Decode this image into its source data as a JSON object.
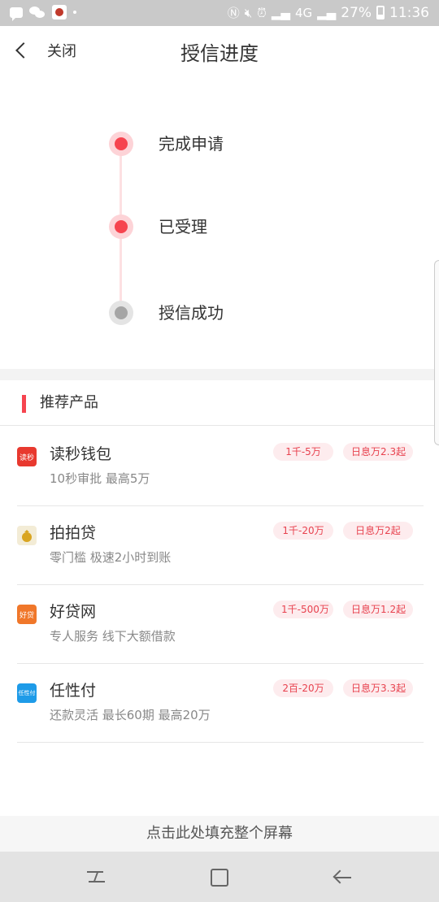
{
  "status_bar": {
    "battery": "27%",
    "time": "11:36",
    "network": "4G",
    "icons": [
      "message-icon",
      "wechat-icon",
      "app-icon",
      "nfc-icon",
      "mute-icon",
      "alarm-icon",
      "signal-icon",
      "battery-icon"
    ]
  },
  "header": {
    "back_label": "关闭",
    "title": "授信进度"
  },
  "progress": {
    "steps": [
      {
        "label": "完成申请",
        "state": "done"
      },
      {
        "label": "已受理",
        "state": "done"
      },
      {
        "label": "授信成功",
        "state": "pending"
      }
    ]
  },
  "recommend": {
    "title": "推荐产品",
    "products": [
      {
        "name": "读秒钱包",
        "desc": "10秒审批 最高5万",
        "amount": "1千-5万",
        "rate": "日息万2.3起",
        "icon": "dumiao-icon",
        "icon_text": "读秒",
        "icon_color": "#e8392f"
      },
      {
        "name": "拍拍贷",
        "desc": "零门槛 极速2小时到账",
        "amount": "1千-20万",
        "rate": "日息万2起",
        "icon": "paipaidai-icon",
        "icon_text": "",
        "icon_color": "#d9a521"
      },
      {
        "name": "好贷网",
        "desc": "专人服务 线下大额借款",
        "amount": "1千-500万",
        "rate": "日息万1.2起",
        "icon": "haodai-icon",
        "icon_text": "好贷",
        "icon_color": "#f0772a"
      },
      {
        "name": "任性付",
        "desc": "还款灵活 最长60期 最高20万",
        "amount": "2百-20万",
        "rate": "日息万3.3起",
        "icon": "renxingfu-icon",
        "icon_text": "任性付",
        "icon_color": "#1e9be8"
      }
    ]
  },
  "fill_screen": "点击此处填充整个屏幕",
  "colors": {
    "accent": "#f6444f",
    "tag_bg": "#fdecee",
    "tag_text": "#e8424f"
  }
}
